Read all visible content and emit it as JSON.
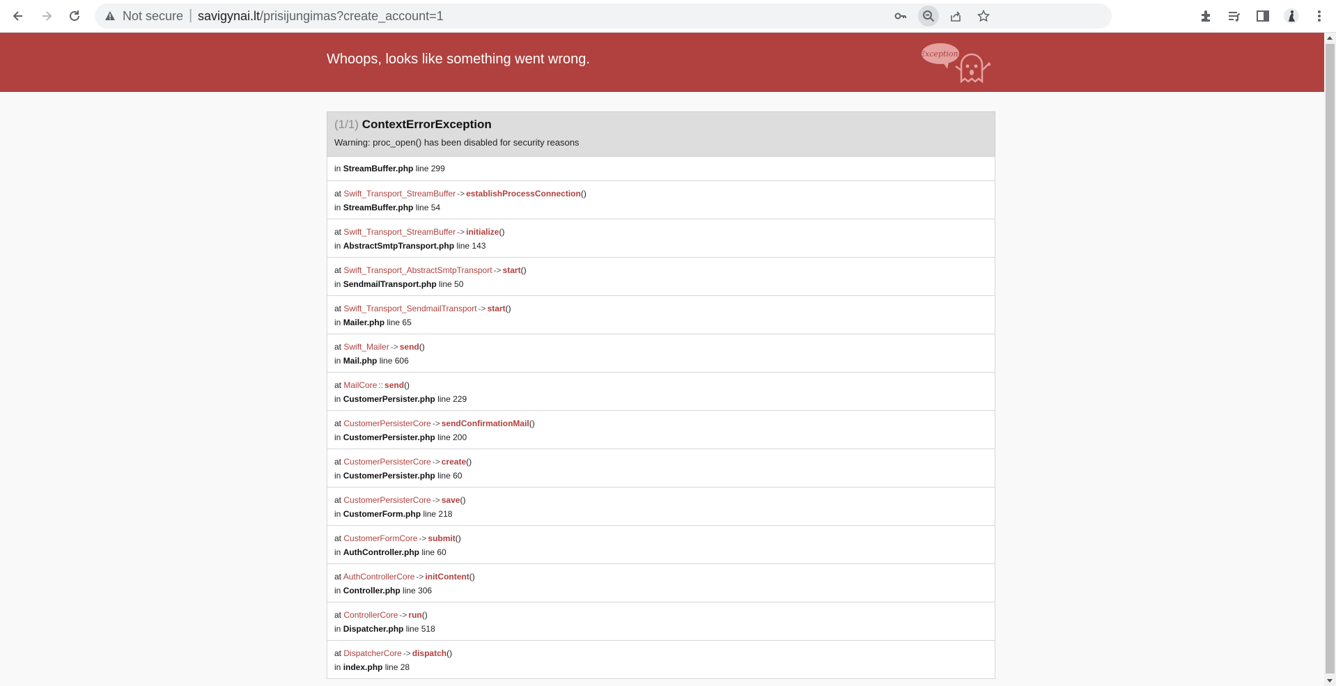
{
  "browser": {
    "security_label": "Not secure",
    "separator": "|",
    "url_host": "savigynai.lt",
    "url_path": "/prisijungimas?create_account=1",
    "colors": {
      "chrome_bg": "#ffffff",
      "omnibox_bg": "#f1f3f4",
      "icon": "#5f6368"
    },
    "icons": [
      "back-arrow-icon",
      "forward-arrow-icon",
      "reload-icon",
      "warning-icon",
      "key-icon",
      "zoom-out-icon",
      "share-icon",
      "star-icon",
      "extensions-icon",
      "reading-list-icon",
      "side-panel-icon",
      "profile-avatar-icon",
      "menu-dots-icon"
    ]
  },
  "banner": {
    "title": "Whoops, looks like something went wrong.",
    "logo_text": "Exception!",
    "color": "#b0413e"
  },
  "exception": {
    "count": "(1/1)",
    "name": "ContextErrorException",
    "message": "Warning: proc_open() has been disabled for security reasons",
    "origin": {
      "in": "in",
      "file": "StreamBuffer.php",
      "line": "line 299"
    },
    "frames": [
      {
        "at": "at",
        "cls": "Swift_Transport_StreamBuffer",
        "op": "->",
        "fn": "establishProcessConnection",
        "parens": "()",
        "in": "in",
        "file": "StreamBuffer.php",
        "line": "line 54"
      },
      {
        "at": "at",
        "cls": "Swift_Transport_StreamBuffer",
        "op": "->",
        "fn": "initialize",
        "parens": "()",
        "in": "in",
        "file": "AbstractSmtpTransport.php",
        "line": "line 143"
      },
      {
        "at": "at",
        "cls": "Swift_Transport_AbstractSmtpTransport",
        "op": "->",
        "fn": "start",
        "parens": "()",
        "in": "in",
        "file": "SendmailTransport.php",
        "line": "line 50"
      },
      {
        "at": "at",
        "cls": "Swift_Transport_SendmailTransport",
        "op": "->",
        "fn": "start",
        "parens": "()",
        "in": "in",
        "file": "Mailer.php",
        "line": "line 65"
      },
      {
        "at": "at",
        "cls": "Swift_Mailer",
        "op": "->",
        "fn": "send",
        "parens": "()",
        "in": "in",
        "file": "Mail.php",
        "line": "line 606"
      },
      {
        "at": "at",
        "cls": "MailCore",
        "op": "::",
        "fn": "send",
        "parens": "()",
        "in": "in",
        "file": "CustomerPersister.php",
        "line": "line 229"
      },
      {
        "at": "at",
        "cls": "CustomerPersisterCore",
        "op": "->",
        "fn": "sendConfirmationMail",
        "parens": "()",
        "in": "in",
        "file": "CustomerPersister.php",
        "line": "line 200"
      },
      {
        "at": "at",
        "cls": "CustomerPersisterCore",
        "op": "->",
        "fn": "create",
        "parens": "()",
        "in": "in",
        "file": "CustomerPersister.php",
        "line": "line 60"
      },
      {
        "at": "at",
        "cls": "CustomerPersisterCore",
        "op": "->",
        "fn": "save",
        "parens": "()",
        "in": "in",
        "file": "CustomerForm.php",
        "line": "line 218"
      },
      {
        "at": "at",
        "cls": "CustomerFormCore",
        "op": "->",
        "fn": "submit",
        "parens": "()",
        "in": "in",
        "file": "AuthController.php",
        "line": "line 60"
      },
      {
        "at": "at",
        "cls": "AuthControllerCore",
        "op": "->",
        "fn": "initContent",
        "parens": "()",
        "in": "in",
        "file": "Controller.php",
        "line": "line 306"
      },
      {
        "at": "at",
        "cls": "ControllerCore",
        "op": "->",
        "fn": "run",
        "parens": "()",
        "in": "in",
        "file": "Dispatcher.php",
        "line": "line 518"
      },
      {
        "at": "at",
        "cls": "DispatcherCore",
        "op": "->",
        "fn": "dispatch",
        "parens": "()",
        "in": "in",
        "file": "index.php",
        "line": "line 28"
      }
    ]
  }
}
